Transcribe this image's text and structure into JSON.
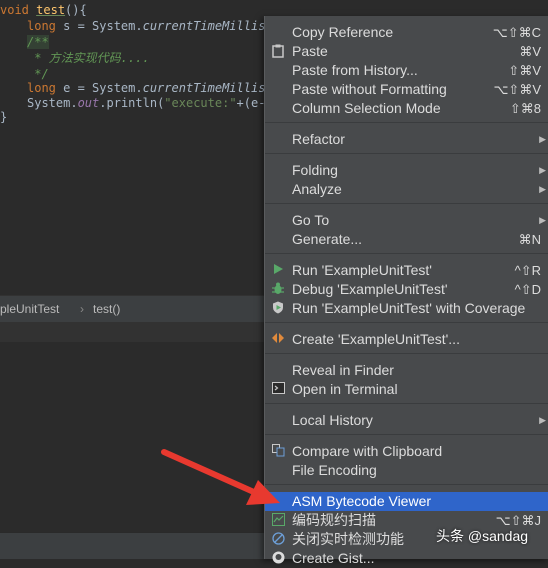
{
  "code": {
    "line1_kw": "void",
    "line1_fn": "test",
    "line1_rest": "(){",
    "line2_kw": "long",
    "line2_text": " s = System.",
    "line2_call": "currentTimeMillis",
    "line2_end": "(",
    "line3": "/**",
    "line4": " * 方法实现代码....",
    "line5": " */",
    "line6_kw": "long",
    "line6_text": " e = System.",
    "line6_call": "currentTimeMillis",
    "line6_end": "(",
    "line7_a": "System.",
    "line7_field": "out",
    "line7_b": ".println(",
    "line7_str": "\"execute:\"",
    "line7_c": "+(e-s",
    "line8": "}"
  },
  "breadcrumb": {
    "class_name": "pleUnitTest",
    "separator": "›",
    "method": "test()"
  },
  "menu": {
    "copy_reference": {
      "label": "Copy Reference",
      "shortcut": "⌥⇧⌘C"
    },
    "paste": {
      "label": "Paste",
      "shortcut": "⌘V"
    },
    "paste_history": {
      "label": "Paste from History...",
      "shortcut": "⇧⌘V"
    },
    "paste_plain": {
      "label": "Paste without Formatting",
      "shortcut": "⌥⇧⌘V"
    },
    "column_mode": {
      "label": "Column Selection Mode",
      "shortcut": "⇧⌘8"
    },
    "refactor": {
      "label": "Refactor"
    },
    "folding": {
      "label": "Folding"
    },
    "analyze": {
      "label": "Analyze"
    },
    "goto": {
      "label": "Go To"
    },
    "generate": {
      "label": "Generate...",
      "shortcut": "⌘N"
    },
    "run": {
      "label": "Run 'ExampleUnitTest'",
      "shortcut": "^⇧R"
    },
    "debug": {
      "label": "Debug 'ExampleUnitTest'",
      "shortcut": "^⇧D"
    },
    "coverage": {
      "label": "Run 'ExampleUnitTest' with Coverage"
    },
    "create": {
      "label": "Create 'ExampleUnitTest'..."
    },
    "reveal": {
      "label": "Reveal in Finder"
    },
    "terminal": {
      "label": "Open in Terminal"
    },
    "local_history": {
      "label": "Local History"
    },
    "compare": {
      "label": "Compare with Clipboard"
    },
    "encoding": {
      "label": "File Encoding"
    },
    "asm": {
      "label": "ASM Bytecode Viewer"
    },
    "scan": {
      "label": "编码规约扫描",
      "shortcut": "⌥⇧⌘J"
    },
    "realtime": {
      "label": "关闭实时检测功能"
    },
    "gist": {
      "label": "Create Gist..."
    }
  },
  "watermark": "头条 @sandag",
  "colors": {
    "selection": "#2f65ca",
    "menu_bg": "#484a4c",
    "arrow": "#e8392f",
    "run_green": "#59a869"
  }
}
